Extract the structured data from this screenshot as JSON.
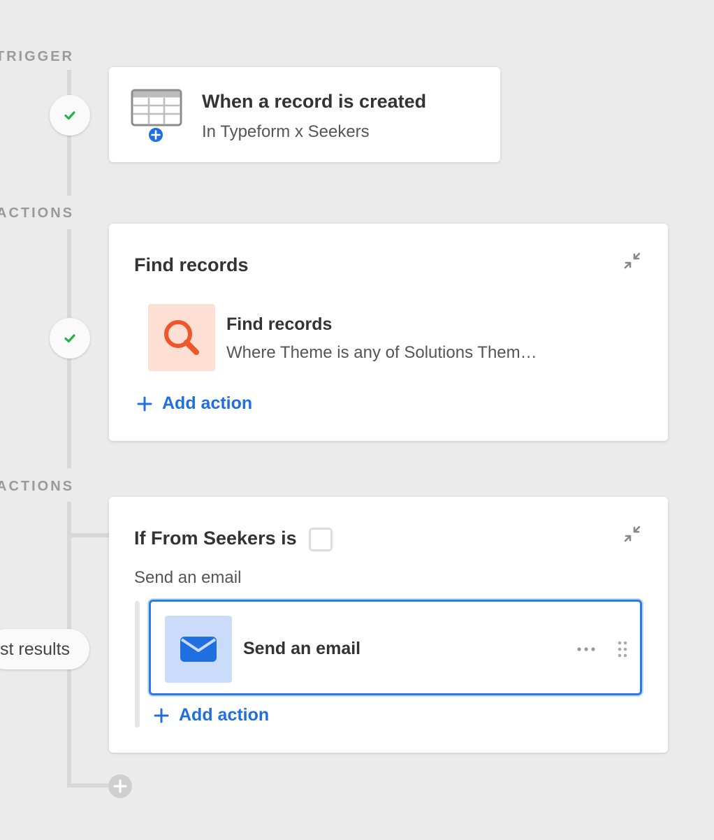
{
  "labels": {
    "trigger": "TRIGGER",
    "actions1": "ACTIONS",
    "actions2": "ACTIONS"
  },
  "trigger_card": {
    "title": "When a record is created",
    "subtitle": "In Typeform x Seekers",
    "icon": "table-plus-icon"
  },
  "find_card": {
    "header": "Find records",
    "item_title": "Find records",
    "item_subtitle": "Where Theme is any of Solutions Them…",
    "add_action": "Add action",
    "icon": "search-icon",
    "icon_color": "#f0562b",
    "icon_bg": "#fddfd3"
  },
  "conditional_card": {
    "title": "If From Seekers is",
    "group_label": "Send an email",
    "item_title": "Send an email",
    "add_action": "Add action",
    "icon": "envelope-icon",
    "icon_color": "#1f6fe0",
    "icon_bg": "#cbdcfb"
  },
  "side_pill": "st results",
  "colors": {
    "accent": "#1f6fe0",
    "check": "#22b34a",
    "background": "#ebebeb"
  }
}
